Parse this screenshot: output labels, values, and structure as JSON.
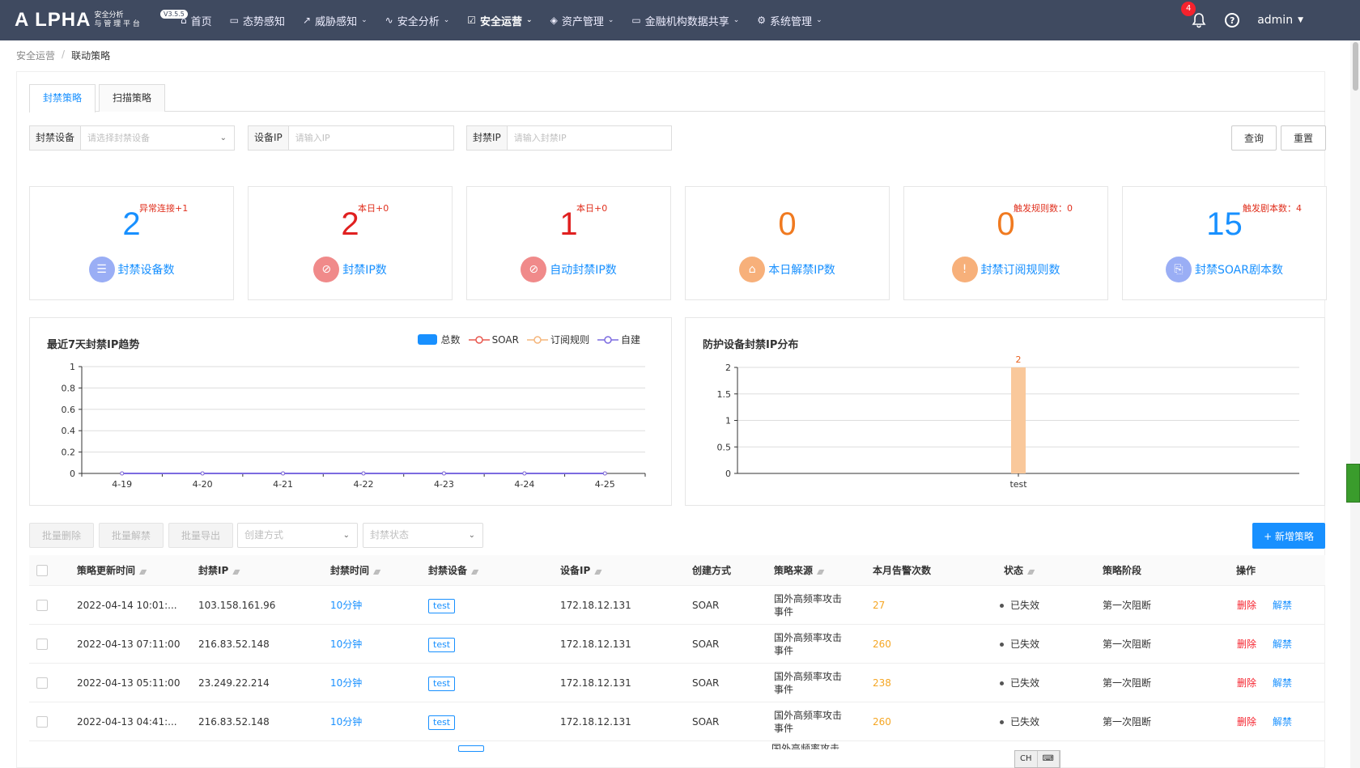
{
  "app": {
    "logo": "A LPHA",
    "logo_sub1": "安全分析",
    "logo_sub2": "与 管 理 平 台",
    "version": "V3.5.5",
    "nav": [
      {
        "label": "首页",
        "has_caret": false
      },
      {
        "label": "态势感知",
        "has_caret": false
      },
      {
        "label": "威胁感知",
        "has_caret": true
      },
      {
        "label": "安全分析",
        "has_caret": true
      },
      {
        "label": "安全运营",
        "has_caret": true,
        "active": true
      },
      {
        "label": "资产管理",
        "has_caret": true
      },
      {
        "label": "金融机构数据共享",
        "has_caret": true
      },
      {
        "label": "系统管理",
        "has_caret": true
      }
    ],
    "notifications": "4",
    "user": "admin",
    "help": "?"
  },
  "breadcrumb": {
    "parent": "安全运营",
    "separator": "/",
    "current": "联动策略"
  },
  "tabs": [
    "封禁策略",
    "扫描策略"
  ],
  "filters": {
    "device": {
      "label": "封禁设备",
      "placeholder": "请选择封禁设备"
    },
    "device_ip": {
      "label": "设备IP",
      "placeholder": "请输入IP"
    },
    "ban_ip": {
      "label": "封禁IP",
      "placeholder": "请输入封禁IP"
    },
    "query": "查询",
    "reset": "重置"
  },
  "stats": [
    {
      "value": "2",
      "delta": "异常连接+1",
      "label": "封禁设备数",
      "color": "#1890ff",
      "icon_bg": "#9aaef5"
    },
    {
      "value": "2",
      "delta": "本日+0",
      "label": "封禁IP数",
      "color": "#e02020",
      "icon_bg": "#f08a8a"
    },
    {
      "value": "1",
      "delta": "本日+0",
      "label": "自动封禁IP数",
      "color": "#e02020",
      "icon_bg": "#f08a8a"
    },
    {
      "value": "0",
      "delta": "",
      "label": "本日解禁IP数",
      "color": "#f07a20",
      "icon_bg": "#f7b07a"
    },
    {
      "value": "0",
      "delta": "触发规则数：0",
      "label": "封禁订阅规则数",
      "color": "#f07a20",
      "icon_bg": "#f7b07a"
    },
    {
      "value": "15",
      "delta": "触发剧本数：4",
      "label": "封禁SOAR剧本数",
      "color": "#1890ff",
      "icon_bg": "#9aaef5"
    }
  ],
  "trend_chart_title": "最近7天封禁IP趋势",
  "dist_chart_title": "防护设备封禁IP分布",
  "chart_data": [
    {
      "type": "line",
      "title": "最近7天封禁IP趋势",
      "x": [
        "4-19",
        "4-20",
        "4-21",
        "4-22",
        "4-23",
        "4-24",
        "4-25"
      ],
      "series": [
        {
          "name": "总数",
          "values": [
            0,
            0,
            0,
            0,
            0,
            0,
            0
          ],
          "color": "#1890ff"
        },
        {
          "name": "SOAR",
          "values": [
            0,
            0,
            0,
            0,
            0,
            0,
            0
          ],
          "color": "#e8584f"
        },
        {
          "name": "订阅规则",
          "values": [
            0,
            0,
            0,
            0,
            0,
            0,
            0
          ],
          "color": "#f5b57a"
        },
        {
          "name": "自建",
          "values": [
            0,
            0,
            0,
            0,
            0,
            0,
            0
          ],
          "color": "#7c6be0"
        }
      ],
      "ylim": [
        0,
        1
      ],
      "yticks": [
        "0",
        "0.2",
        "0.4",
        "0.6",
        "0.8",
        "1"
      ],
      "grid": true,
      "legend": "top-right"
    },
    {
      "type": "bar",
      "title": "防护设备封禁IP分布",
      "categories": [
        "test"
      ],
      "values": [
        2
      ],
      "ylim": [
        0,
        2
      ],
      "yticks": [
        "0",
        "0.5",
        "1",
        "1.5",
        "2"
      ],
      "bar_color": "#f9c89b",
      "label_color": "#e8611e",
      "grid": true
    }
  ],
  "actions": {
    "batch_delete": "批量删除",
    "batch_unban": "批量解禁",
    "batch_export": "批量导出",
    "create_method": "创建方式",
    "ban_status": "封禁状态",
    "add": "+ 新增策略"
  },
  "table": {
    "headers": [
      "策略更新时间",
      "封禁IP",
      "封禁时间",
      "封禁设备",
      "设备IP",
      "创建方式",
      "策略来源",
      "本月告警次数",
      "状态",
      "策略阶段",
      "操作"
    ],
    "rows": [
      {
        "time": "2022-04-14 10:01:...",
        "ip": "103.158.161.96",
        "duration": "10分钟",
        "device": "test",
        "device_ip": "172.18.12.131",
        "method": "SOAR",
        "source1": "国外高频率攻击",
        "source2": "事件",
        "alerts": "27",
        "status": "已失效",
        "stage": "第一次阻断",
        "op_delete": "删除",
        "op_unban": "解禁"
      },
      {
        "time": "2022-04-13 07:11:00",
        "ip": "216.83.52.148",
        "duration": "10分钟",
        "device": "test",
        "device_ip": "172.18.12.131",
        "method": "SOAR",
        "source1": "国外高频率攻击",
        "source2": "事件",
        "alerts": "260",
        "status": "已失效",
        "stage": "第一次阻断",
        "op_delete": "删除",
        "op_unban": "解禁"
      },
      {
        "time": "2022-04-13 05:11:00",
        "ip": "23.249.22.214",
        "duration": "10分钟",
        "device": "test",
        "device_ip": "172.18.12.131",
        "method": "SOAR",
        "source1": "国外高频率攻击",
        "source2": "事件",
        "alerts": "238",
        "status": "已失效",
        "stage": "第一次阻断",
        "op_delete": "删除",
        "op_unban": "解禁"
      },
      {
        "time": "2022-04-13 04:41:...",
        "ip": "216.83.52.148",
        "duration": "10分钟",
        "device": "test",
        "device_ip": "172.18.12.131",
        "method": "SOAR",
        "source1": "国外高频率攻击",
        "source2": "事件",
        "alerts": "260",
        "status": "已失效",
        "stage": "第一次阻断",
        "op_delete": "删除",
        "op_unban": "解禁"
      }
    ],
    "partial_row_source": "国外高频率攻击"
  },
  "ime": {
    "lang": "CH"
  }
}
